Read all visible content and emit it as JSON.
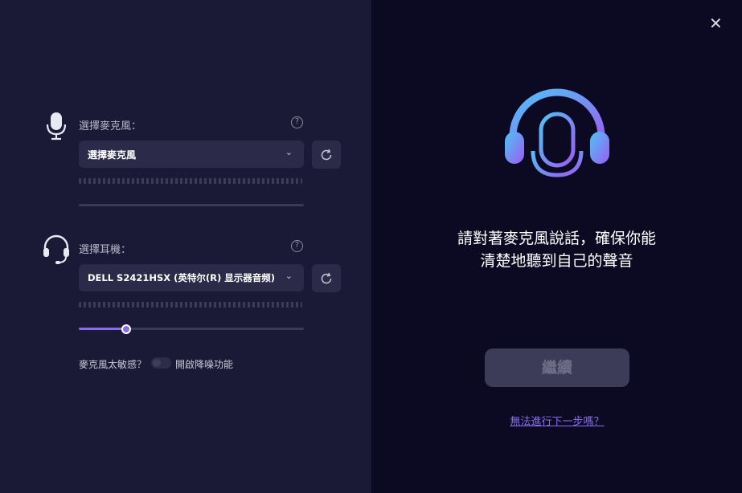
{
  "window": {
    "close_glyph": "✕"
  },
  "mic_section": {
    "icon": "microphone-icon",
    "label": "選擇麥克風：",
    "help": "?",
    "select_value": "選擇麥克風",
    "chevron": "⌄",
    "refresh_icon": "refresh-icon",
    "level_track_filled": 0
  },
  "headset_section": {
    "icon": "headset-icon",
    "label": "選擇耳機：",
    "help": "?",
    "select_value": "DELL S2421HSX (英特尔(R) 显示器音频)",
    "chevron": "⌄",
    "refresh_icon": "refresh-icon",
    "volume_fraction": 0.21
  },
  "noise": {
    "question": "麥克風太敏感？",
    "toggle_on": false,
    "label": "開啟降噪功能"
  },
  "right_panel": {
    "illustration": "headphones-microphone-icon",
    "headline_line1": "請對著麥克風說話，確保你能",
    "headline_line2": "清楚地聽到自己的聲音",
    "continue_label": "繼續",
    "cant_proceed_link": "無法進行下一步嗎？"
  },
  "colors": {
    "accent": "#8b6bf0",
    "left_bg": "#1b1a36",
    "right_bg": "#0c0a22",
    "gradient_start": "#4fc3f7",
    "gradient_end": "#9b5cf0"
  }
}
